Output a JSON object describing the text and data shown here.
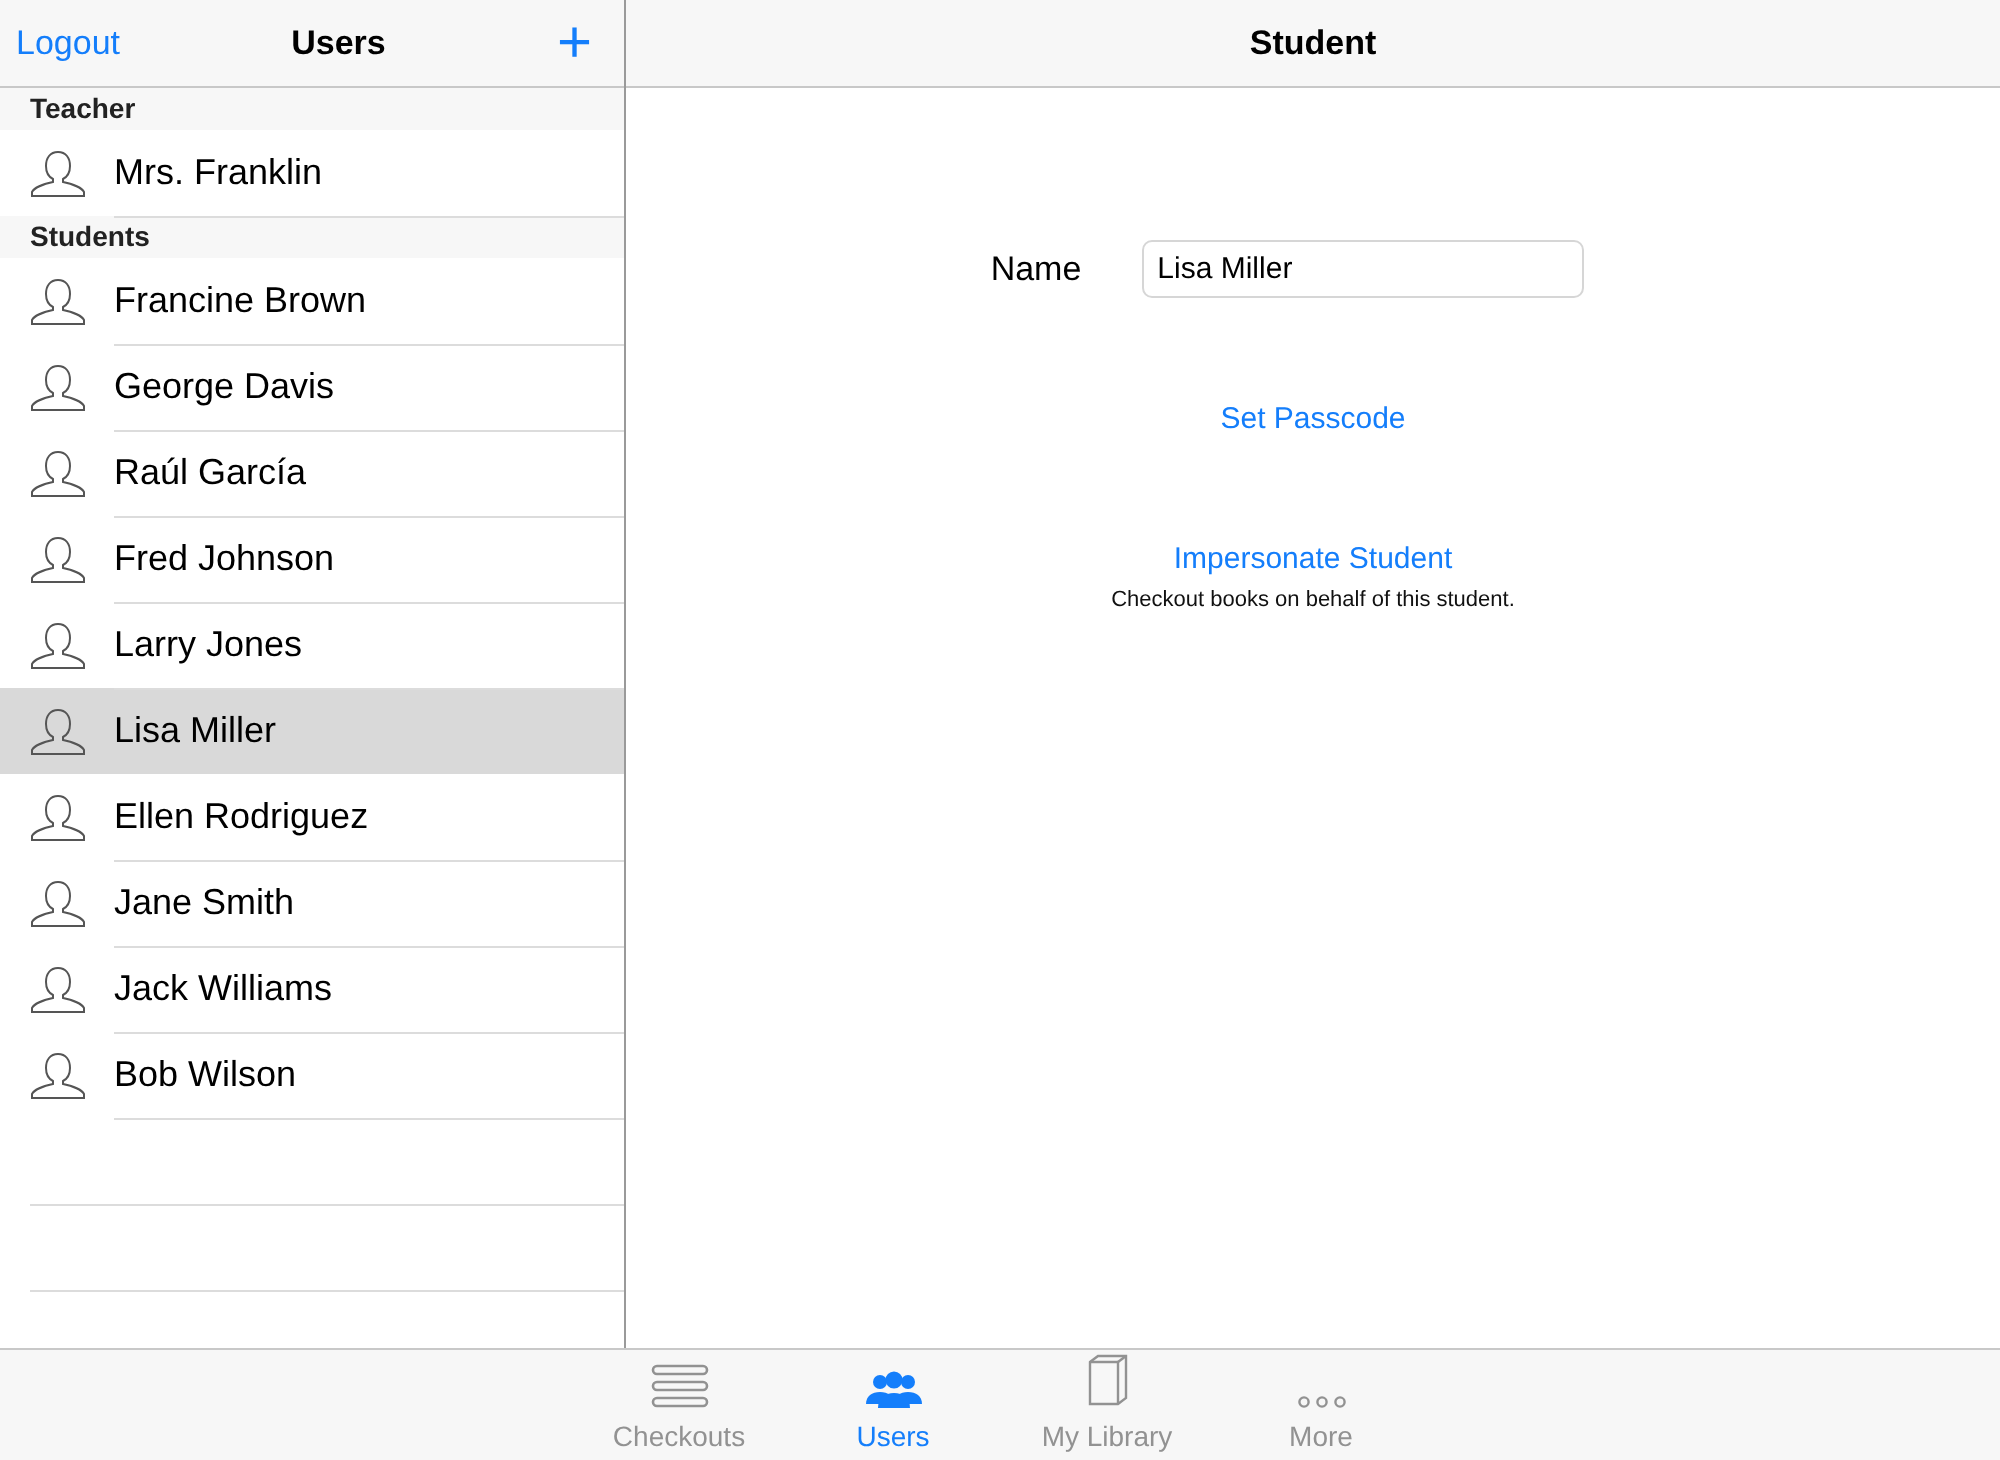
{
  "sidebar": {
    "logout": "Logout",
    "title": "Users",
    "add": "+",
    "sections": [
      {
        "title": "Teacher",
        "items": [
          {
            "name": "Mrs. Franklin",
            "selected": false
          }
        ]
      },
      {
        "title": "Students",
        "items": [
          {
            "name": "Francine Brown",
            "selected": false
          },
          {
            "name": "George Davis",
            "selected": false
          },
          {
            "name": "Raúl García",
            "selected": false
          },
          {
            "name": "Fred Johnson",
            "selected": false
          },
          {
            "name": "Larry Jones",
            "selected": false
          },
          {
            "name": "Lisa Miller",
            "selected": true
          },
          {
            "name": "Ellen Rodriguez",
            "selected": false
          },
          {
            "name": "Jane Smith",
            "selected": false
          },
          {
            "name": "Jack Williams",
            "selected": false
          },
          {
            "name": "Bob Wilson",
            "selected": false
          }
        ]
      }
    ]
  },
  "detail": {
    "title": "Student",
    "name_label": "Name",
    "name_value": "Lisa Miller",
    "set_passcode": "Set Passcode",
    "impersonate": "Impersonate Student",
    "impersonate_note": "Checkout books on behalf of this student."
  },
  "tabs": [
    {
      "label": "Checkouts",
      "kind": "list",
      "selected": false
    },
    {
      "label": "Users",
      "kind": "users",
      "selected": true
    },
    {
      "label": "My Library",
      "kind": "book",
      "selected": false
    },
    {
      "label": "More",
      "kind": "more",
      "selected": false
    }
  ]
}
